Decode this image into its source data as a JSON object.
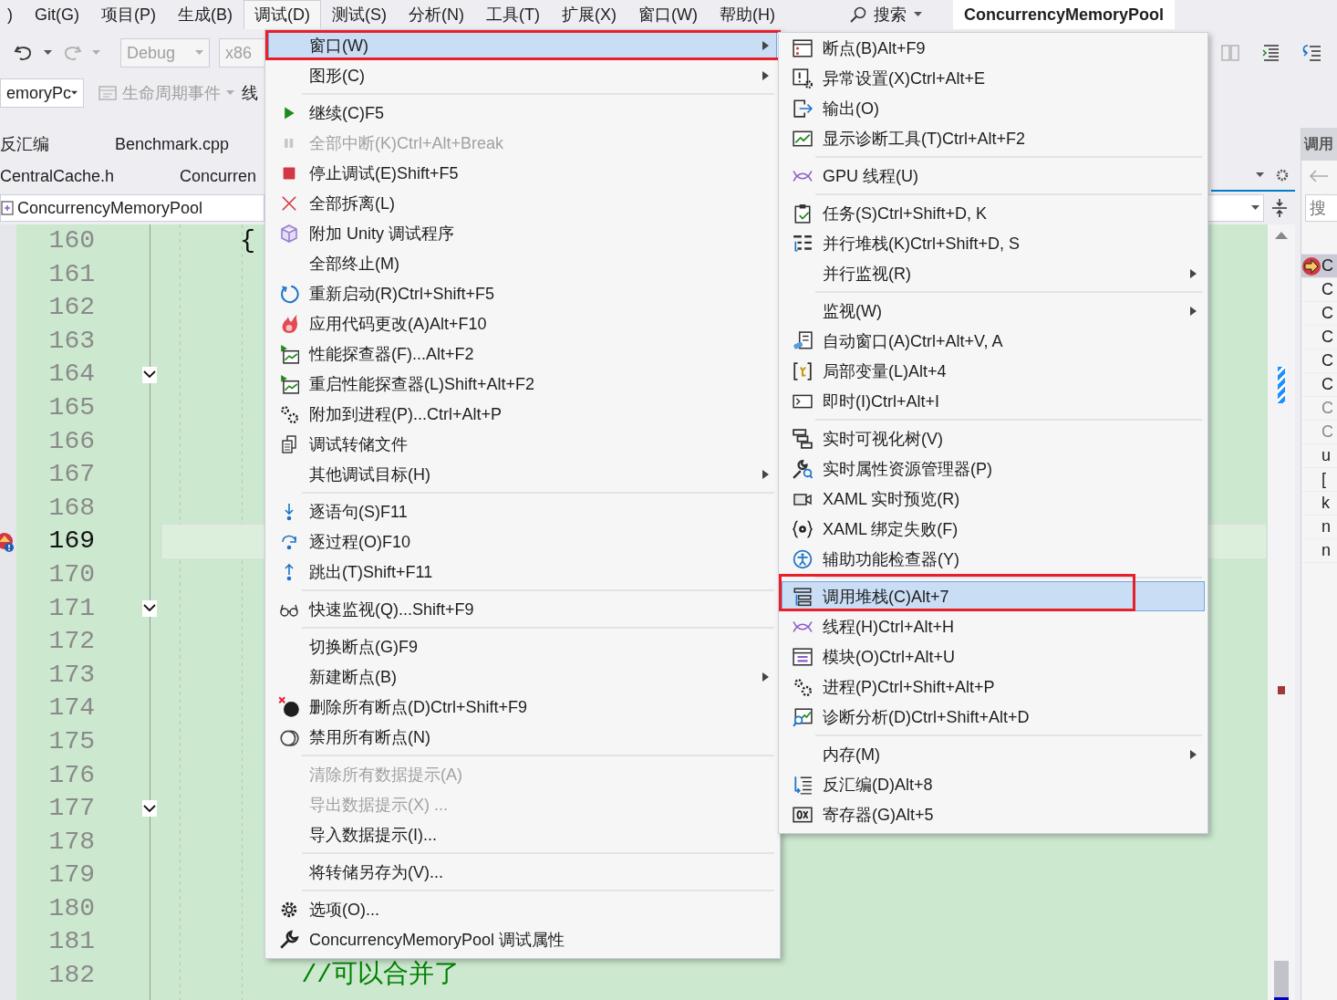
{
  "menu_bar": {
    "items": [
      {
        "label": ")",
        "selected": false
      },
      {
        "label": "Git(G)",
        "selected": false
      },
      {
        "label": "项目(P)",
        "selected": false
      },
      {
        "label": "生成(B)",
        "selected": false
      },
      {
        "label": "调试(D)",
        "selected": true
      },
      {
        "label": "测试(S)",
        "selected": false
      },
      {
        "label": "分析(N)",
        "selected": false
      },
      {
        "label": "工具(T)",
        "selected": false
      },
      {
        "label": "扩展(X)",
        "selected": false
      },
      {
        "label": "窗口(W)",
        "selected": false
      },
      {
        "label": "帮助(H)",
        "selected": false
      }
    ],
    "search": "搜索",
    "solution_title": "ConcurrencyMemoryPool"
  },
  "toolbar": {
    "configuration": "Debug",
    "platform": "x86"
  },
  "toolbar_2": {
    "project": "emoryPc",
    "lifecycle_events": "生命周期事件",
    "cut_label": "线"
  },
  "document_tabs": [
    {
      "label": "反汇编"
    },
    {
      "label": "Benchmark.cpp"
    }
  ],
  "document_tabs_2": [
    {
      "label": "CentralCache.h"
    },
    {
      "label": "Concurren"
    }
  ],
  "navigation_bar": {
    "scope": "ConcurrencyMemoryPool"
  },
  "editor": {
    "lines": [
      {
        "number": "160",
        "code": "    {",
        "collapsible": false,
        "current": false
      },
      {
        "number": "161",
        "collapsible": false,
        "current": false
      },
      {
        "number": "162",
        "collapsible": false,
        "current": false
      },
      {
        "number": "163",
        "collapsible": false,
        "current": false
      },
      {
        "number": "164",
        "collapsible": true,
        "current": false
      },
      {
        "number": "165",
        "collapsible": false,
        "current": false
      },
      {
        "number": "166",
        "collapsible": false,
        "current": false
      },
      {
        "number": "167",
        "collapsible": false,
        "current": false
      },
      {
        "number": "168",
        "collapsible": false,
        "current": false
      },
      {
        "number": "169",
        "collapsible": false,
        "current": true
      },
      {
        "number": "170",
        "collapsible": false,
        "current": false
      },
      {
        "number": "171",
        "collapsible": true,
        "current": false
      },
      {
        "number": "172",
        "collapsible": false,
        "current": false
      },
      {
        "number": "173",
        "collapsible": false,
        "current": false
      },
      {
        "number": "174",
        "collapsible": false,
        "current": false
      },
      {
        "number": "175",
        "collapsible": false,
        "current": false
      },
      {
        "number": "176",
        "collapsible": false,
        "current": false
      },
      {
        "number": "177",
        "collapsible": true,
        "current": false
      },
      {
        "number": "178",
        "collapsible": false,
        "current": false
      },
      {
        "number": "179",
        "collapsible": false,
        "current": false
      },
      {
        "number": "180",
        "collapsible": false,
        "current": false
      },
      {
        "number": "181",
        "collapsible": false,
        "current": false
      },
      {
        "number": "182",
        "code": "        //可以合并了",
        "collapsible": false,
        "current": false
      }
    ]
  },
  "call_stack_panel": {
    "title": "调用",
    "search_placeholder": "搜",
    "rows": [
      {
        "text": "C",
        "current": true,
        "dimmed": false
      },
      {
        "text": "C",
        "current": false,
        "dimmed": false
      },
      {
        "text": "C",
        "current": false,
        "dimmed": false
      },
      {
        "text": "C",
        "current": false,
        "dimmed": false
      },
      {
        "text": "C",
        "current": false,
        "dimmed": false
      },
      {
        "text": "C",
        "current": false,
        "dimmed": false
      },
      {
        "text": "C",
        "current": false,
        "dimmed": true
      },
      {
        "text": "C",
        "current": false,
        "dimmed": true
      },
      {
        "text": "u",
        "current": false,
        "dimmed": false
      },
      {
        "text": "[",
        "current": false,
        "dimmed": false
      },
      {
        "text": "k",
        "current": false,
        "dimmed": false
      },
      {
        "text": "n",
        "current": false,
        "dimmed": false
      },
      {
        "text": "n",
        "current": false,
        "dimmed": false
      }
    ]
  },
  "debug_menu": {
    "entries": [
      {
        "kind": "item",
        "label": "窗口(W)",
        "submenu": true,
        "disabled": false,
        "selected": true,
        "highlighted": true
      },
      {
        "kind": "item",
        "label": "图形(C)",
        "submenu": true,
        "disabled": false,
        "selected": false,
        "highlighted": false
      },
      {
        "kind": "separator"
      },
      {
        "kind": "item",
        "label": "继续(C)",
        "shortcut": "F5",
        "submenu": false,
        "disabled": false,
        "selected": false,
        "highlighted": false
      },
      {
        "kind": "item",
        "label": "全部中断(K)",
        "shortcut": "Ctrl+Alt+Break",
        "submenu": false,
        "disabled": true,
        "selected": false,
        "highlighted": false
      },
      {
        "kind": "item",
        "label": "停止调试(E)",
        "shortcut": "Shift+F5",
        "submenu": false,
        "disabled": false,
        "selected": false,
        "highlighted": false
      },
      {
        "kind": "item",
        "label": "全部拆离(L)",
        "submenu": false,
        "disabled": false,
        "selected": false,
        "highlighted": false
      },
      {
        "kind": "item",
        "label": "附加 Unity 调试程序",
        "submenu": false,
        "disabled": false,
        "selected": false,
        "highlighted": false
      },
      {
        "kind": "item",
        "label": "全部终止(M)",
        "submenu": false,
        "disabled": false,
        "selected": false,
        "highlighted": false
      },
      {
        "kind": "item",
        "label": "重新启动(R)",
        "shortcut": "Ctrl+Shift+F5",
        "submenu": false,
        "disabled": false,
        "selected": false,
        "highlighted": false
      },
      {
        "kind": "item",
        "label": "应用代码更改(A)",
        "shortcut": "Alt+F10",
        "submenu": false,
        "disabled": false,
        "selected": false,
        "highlighted": false
      },
      {
        "kind": "item",
        "label": "性能探查器(F)...",
        "shortcut": "Alt+F2",
        "submenu": false,
        "disabled": false,
        "selected": false,
        "highlighted": false
      },
      {
        "kind": "item",
        "label": "重启性能探查器(L)",
        "shortcut": "Shift+Alt+F2",
        "submenu": false,
        "disabled": false,
        "selected": false,
        "highlighted": false
      },
      {
        "kind": "item",
        "label": "附加到进程(P)...",
        "shortcut": "Ctrl+Alt+P",
        "submenu": false,
        "disabled": false,
        "selected": false,
        "highlighted": false
      },
      {
        "kind": "item",
        "label": "调试转储文件",
        "submenu": false,
        "disabled": false,
        "selected": false,
        "highlighted": false
      },
      {
        "kind": "item",
        "label": "其他调试目标(H)",
        "submenu": true,
        "disabled": false,
        "selected": false,
        "highlighted": false
      },
      {
        "kind": "separator"
      },
      {
        "kind": "item",
        "label": "逐语句(S)",
        "shortcut": "F11",
        "submenu": false,
        "disabled": false,
        "selected": false,
        "highlighted": false
      },
      {
        "kind": "item",
        "label": "逐过程(O)",
        "shortcut": "F10",
        "submenu": false,
        "disabled": false,
        "selected": false,
        "highlighted": false
      },
      {
        "kind": "item",
        "label": "跳出(T)",
        "shortcut": "Shift+F11",
        "submenu": false,
        "disabled": false,
        "selected": false,
        "highlighted": false
      },
      {
        "kind": "separator"
      },
      {
        "kind": "item",
        "label": "快速监视(Q)...",
        "shortcut": "Shift+F9",
        "submenu": false,
        "disabled": false,
        "selected": false,
        "highlighted": false
      },
      {
        "kind": "separator"
      },
      {
        "kind": "item",
        "label": "切换断点(G)",
        "shortcut": "F9",
        "submenu": false,
        "disabled": false,
        "selected": false,
        "highlighted": false
      },
      {
        "kind": "item",
        "label": "新建断点(B)",
        "submenu": true,
        "disabled": false,
        "selected": false,
        "highlighted": false
      },
      {
        "kind": "item",
        "label": "删除所有断点(D)",
        "shortcut": "Ctrl+Shift+F9",
        "submenu": false,
        "disabled": false,
        "selected": false,
        "highlighted": false
      },
      {
        "kind": "item",
        "label": "禁用所有断点(N)",
        "submenu": false,
        "disabled": false,
        "selected": false,
        "highlighted": false
      },
      {
        "kind": "separator"
      },
      {
        "kind": "item",
        "label": "清除所有数据提示(A)",
        "submenu": false,
        "disabled": true,
        "selected": false,
        "highlighted": false
      },
      {
        "kind": "item",
        "label": "导出数据提示(X) ...",
        "submenu": false,
        "disabled": true,
        "selected": false,
        "highlighted": false
      },
      {
        "kind": "item",
        "label": "导入数据提示(I)...",
        "submenu": false,
        "disabled": false,
        "selected": false,
        "highlighted": false
      },
      {
        "kind": "separator"
      },
      {
        "kind": "item",
        "label": "将转储另存为(V)...",
        "submenu": false,
        "disabled": false,
        "selected": false,
        "highlighted": false
      },
      {
        "kind": "separator"
      },
      {
        "kind": "item",
        "label": "选项(O)...",
        "submenu": false,
        "disabled": false,
        "selected": false,
        "highlighted": false
      },
      {
        "kind": "item",
        "label": "ConcurrencyMemoryPool 调试属性",
        "submenu": false,
        "disabled": false,
        "selected": false,
        "highlighted": false
      }
    ]
  },
  "window_submenu": {
    "entries": [
      {
        "kind": "item",
        "label": "断点(B)",
        "shortcut": "Alt+F9",
        "submenu": false,
        "selected": false,
        "highlighted": false
      },
      {
        "kind": "item",
        "label": "异常设置(X)",
        "shortcut": "Ctrl+Alt+E",
        "submenu": false,
        "selected": false,
        "highlighted": false
      },
      {
        "kind": "item",
        "label": "输出(O)",
        "submenu": false,
        "selected": false,
        "highlighted": false
      },
      {
        "kind": "item",
        "label": "显示诊断工具(T)",
        "shortcut": "Ctrl+Alt+F2",
        "submenu": false,
        "selected": false,
        "highlighted": false
      },
      {
        "kind": "separator"
      },
      {
        "kind": "item",
        "label": "GPU 线程(U)",
        "submenu": false,
        "selected": false,
        "highlighted": false
      },
      {
        "kind": "separator"
      },
      {
        "kind": "item",
        "label": "任务(S)",
        "shortcut": "Ctrl+Shift+D, K",
        "submenu": false,
        "selected": false,
        "highlighted": false
      },
      {
        "kind": "item",
        "label": "并行堆栈(K)",
        "shortcut": "Ctrl+Shift+D, S",
        "submenu": false,
        "selected": false,
        "highlighted": false
      },
      {
        "kind": "item",
        "label": "并行监视(R)",
        "submenu": true,
        "selected": false,
        "highlighted": false
      },
      {
        "kind": "separator"
      },
      {
        "kind": "item",
        "label": "监视(W)",
        "submenu": true,
        "selected": false,
        "highlighted": false
      },
      {
        "kind": "item",
        "label": "自动窗口(A)",
        "shortcut": "Ctrl+Alt+V, A",
        "submenu": false,
        "selected": false,
        "highlighted": false
      },
      {
        "kind": "item",
        "label": "局部变量(L)",
        "shortcut": "Alt+4",
        "submenu": false,
        "selected": false,
        "highlighted": false
      },
      {
        "kind": "item",
        "label": "即时(I)",
        "shortcut": "Ctrl+Alt+I",
        "submenu": false,
        "selected": false,
        "highlighted": false
      },
      {
        "kind": "separator"
      },
      {
        "kind": "item",
        "label": "实时可视化树(V)",
        "submenu": false,
        "selected": false,
        "highlighted": false
      },
      {
        "kind": "item",
        "label": "实时属性资源管理器(P)",
        "submenu": false,
        "selected": false,
        "highlighted": false
      },
      {
        "kind": "item",
        "label": "XAML 实时预览(R)",
        "submenu": false,
        "selected": false,
        "highlighted": false
      },
      {
        "kind": "item",
        "label": "XAML 绑定失败(F)",
        "submenu": false,
        "selected": false,
        "highlighted": false
      },
      {
        "kind": "item",
        "label": "辅助功能检查器(Y)",
        "submenu": false,
        "selected": false,
        "highlighted": false
      },
      {
        "kind": "separator"
      },
      {
        "kind": "item",
        "label": "调用堆栈(C)",
        "shortcut": "Alt+7",
        "submenu": false,
        "selected": true,
        "highlighted": true
      },
      {
        "kind": "item",
        "label": "线程(H)",
        "shortcut": "Ctrl+Alt+H",
        "submenu": false,
        "selected": false,
        "highlighted": false
      },
      {
        "kind": "item",
        "label": "模块(O)",
        "shortcut": "Ctrl+Alt+U",
        "submenu": false,
        "selected": false,
        "highlighted": false
      },
      {
        "kind": "item",
        "label": "进程(P)",
        "shortcut": "Ctrl+Shift+Alt+P",
        "submenu": false,
        "selected": false,
        "highlighted": false
      },
      {
        "kind": "item",
        "label": "诊断分析(D)",
        "shortcut": "Ctrl+Shift+Alt+D",
        "submenu": false,
        "selected": false,
        "highlighted": false
      },
      {
        "kind": "separator"
      },
      {
        "kind": "item",
        "label": "内存(M)",
        "submenu": true,
        "selected": false,
        "highlighted": false
      },
      {
        "kind": "item",
        "label": "反汇编(D)",
        "shortcut": "Alt+8",
        "submenu": false,
        "selected": false,
        "highlighted": false
      },
      {
        "kind": "item",
        "label": "寄存器(G)",
        "shortcut": "Alt+5",
        "submenu": false,
        "selected": false,
        "highlighted": false
      }
    ]
  }
}
